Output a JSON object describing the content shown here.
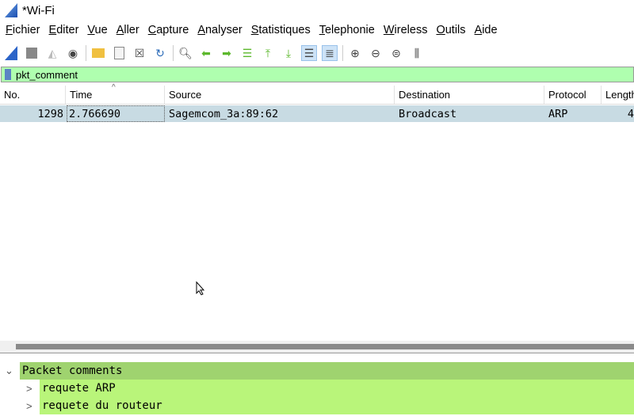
{
  "window": {
    "title": "*Wi-Fi"
  },
  "menu": [
    "Fichier",
    "Editer",
    "Vue",
    "Aller",
    "Capture",
    "Analyser",
    "Statistiques",
    "Telephonie",
    "Wireless",
    "Outils",
    "Aide"
  ],
  "filter": {
    "value": "pkt_comment"
  },
  "columns": [
    "No.",
    "Time",
    "Source",
    "Destination",
    "Protocol",
    "Length"
  ],
  "rows": [
    {
      "no": "1298",
      "time": "2.766690",
      "source": "Sagemcom_3a:89:62",
      "destination": "Broadcast",
      "protocol": "ARP",
      "length": "4"
    }
  ],
  "details": {
    "title": "Packet comments",
    "items": [
      "requete ARP",
      "requete du routeur"
    ]
  },
  "colors": {
    "filter_bg": "#afffaf",
    "row_selected": "#c8dbe3",
    "detail_header": "#9fd36f",
    "detail_item": "#b9f57a"
  }
}
